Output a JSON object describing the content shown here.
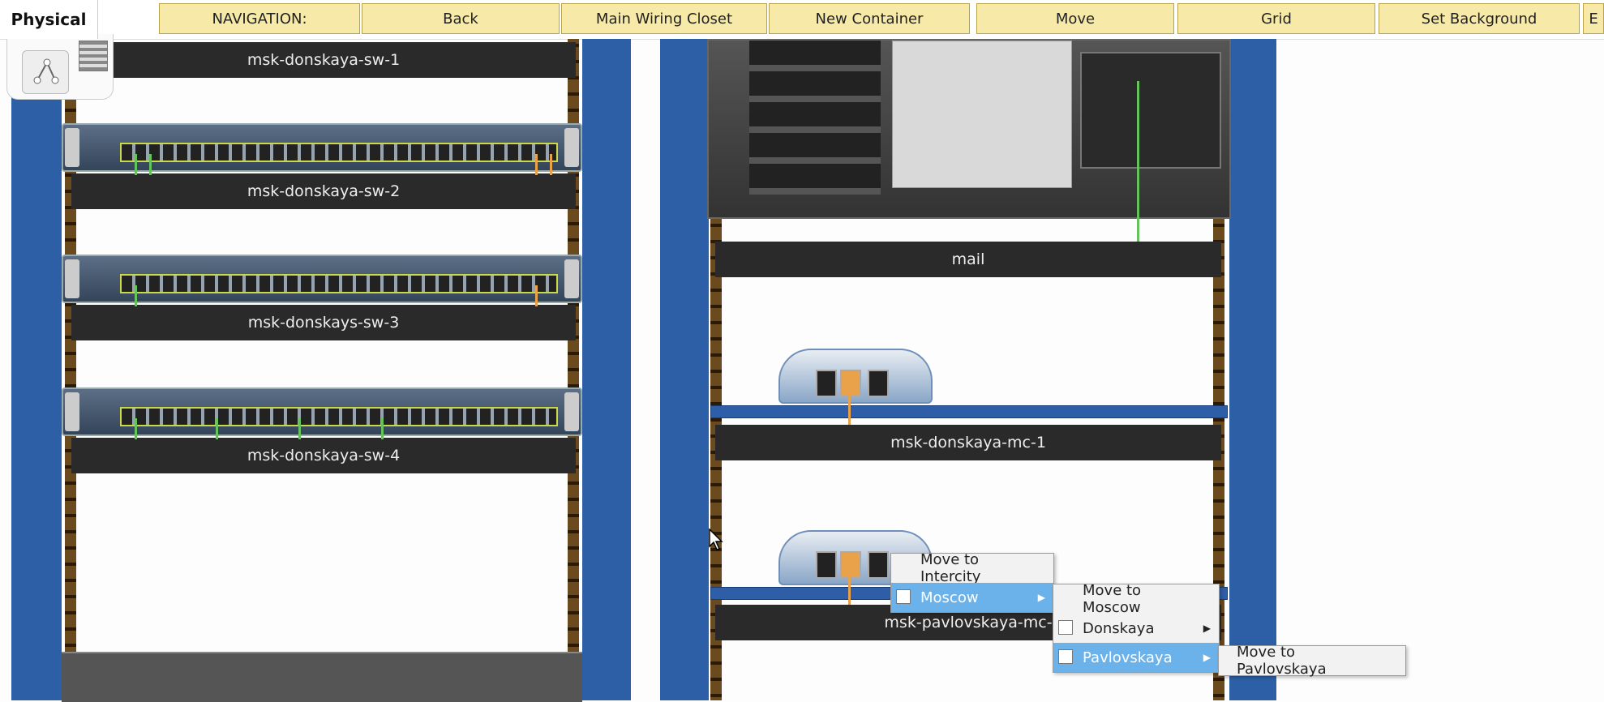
{
  "toolbar": {
    "physical_label": "Physical",
    "buttons": [
      "NAVIGATION:",
      "Back",
      "Main Wiring Closet",
      "New Container",
      "Move",
      "Grid",
      "Set Background",
      "E"
    ]
  },
  "rack_left": {
    "devices": [
      "msk-donskaya-sw-1",
      "msk-donskaya-sw-2",
      "msk-donskays-sw-3",
      "msk-donskaya-sw-4"
    ]
  },
  "rack_right": {
    "devices": [
      "mail",
      "msk-donskaya-mc-1",
      "msk-pavlovskaya-mc-"
    ]
  },
  "context_menu": {
    "level1": [
      "Move to Intercity",
      "Moscow"
    ],
    "level2": [
      "Move to Moscow",
      "Donskaya",
      "Pavlovskaya"
    ],
    "level3": [
      "Move to Pavlovskaya"
    ]
  },
  "colors": {
    "toolbar_button": "#f7e9a7",
    "rack_rail": "#2d5fa6",
    "menu_highlight": "#6cb2ea"
  }
}
